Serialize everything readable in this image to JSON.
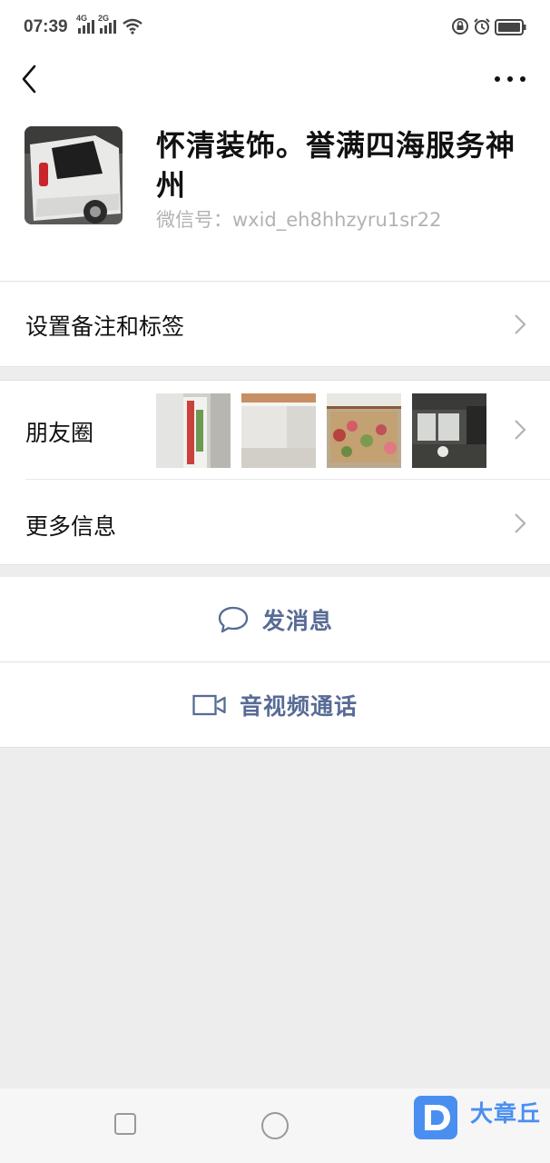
{
  "status_bar": {
    "time": "07:39",
    "net1": "4G",
    "net2": "2G",
    "icons": [
      "signal-icon",
      "wifi-icon",
      "lock-rotation-icon",
      "alarm-icon",
      "battery-icon"
    ]
  },
  "header": {
    "back_icon": "back-chevron-icon",
    "more_icon": "more-dots-icon"
  },
  "profile": {
    "name": "怀清装饰。誉满四海服务神州",
    "wxid": "微信号：wxid_eh8hhzyru1sr22"
  },
  "cells": {
    "remark": "设置备注和标签",
    "moments": "朋友圈",
    "more_info": "更多信息"
  },
  "actions": {
    "message": "发消息",
    "call": "音视频通话"
  },
  "watermark": {
    "text": "大章丘"
  },
  "colors": {
    "link": "#576b95",
    "background": "#ededed",
    "card": "#ffffff"
  }
}
